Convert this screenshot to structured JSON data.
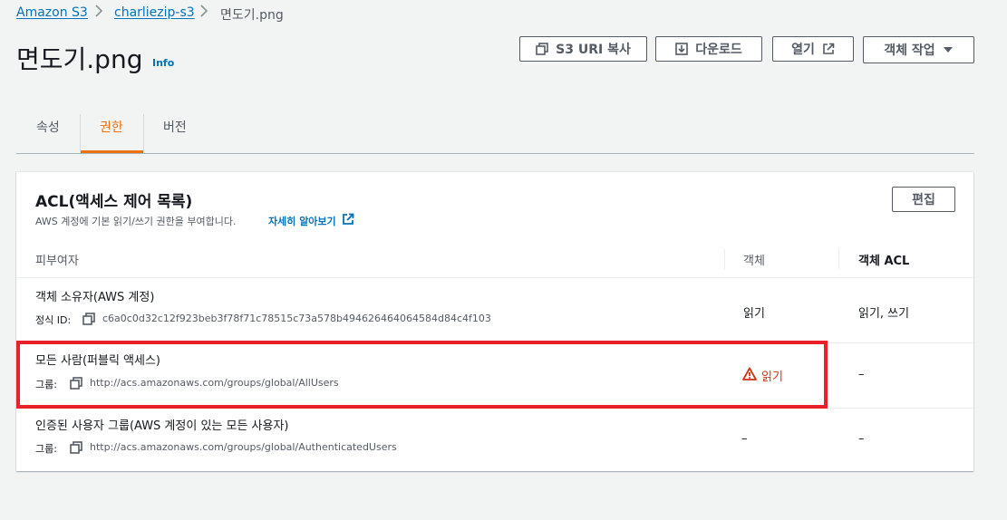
{
  "breadcrumb": {
    "items": [
      "Amazon S3",
      "charliezip-s3",
      "면도기.png"
    ]
  },
  "header": {
    "title": "면도기.png",
    "info": "Info",
    "buttons": {
      "copy_uri": "S3 URI 복사",
      "download": "다운로드",
      "open": "열기",
      "actions": "객체 작업"
    }
  },
  "tabs": [
    {
      "label": "속성",
      "active": false
    },
    {
      "label": "권한",
      "active": true
    },
    {
      "label": "버전",
      "active": false
    }
  ],
  "acl": {
    "title": "ACL(액세스 제어 목록)",
    "description": "AWS 계정에 기본 읽기/쓰기 권한을 부여합니다.",
    "learn_more": "자세히 알아보기",
    "edit": "편집",
    "columns": [
      "피부여자",
      "객체",
      "객체 ACL"
    ],
    "rows": [
      {
        "grantee": "객체 소유자(AWS 계정)",
        "sub_label": "정식 ID:",
        "sub_value": "c6a0c0d32c12f923beb3f78f71c78515c73a578b494626464064584d84c4f103",
        "object": "읽기",
        "object_acl": "읽기, 쓰기"
      },
      {
        "grantee": "모든 사람(퍼블릭 액세스)",
        "sub_label": "그룹:",
        "sub_value": "http://acs.amazonaws.com/groups/global/AllUsers",
        "object": "읽기",
        "object_warning": true,
        "object_acl": "–"
      },
      {
        "grantee": "인증된 사용자 그룹(AWS 계정이 있는 모든 사용자)",
        "sub_label": "그룹:",
        "sub_value": "http://acs.amazonaws.com/groups/global/AuthenticatedUsers",
        "object": "–",
        "object_acl": "–"
      }
    ]
  },
  "colors": {
    "link": "#0073bb",
    "active_tab": "#ec7211",
    "warning": "#d13212",
    "highlight": "#e8202a"
  }
}
